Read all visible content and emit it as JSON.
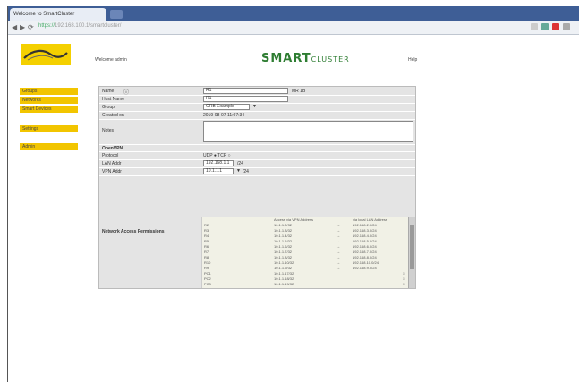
{
  "browser": {
    "tab_title": "Welcome to SmartCluster",
    "url_secure": "https://",
    "url_rest": "192.168.100.1/smartcluster/",
    "back": "◀",
    "forward": "▶",
    "reload": "⟳"
  },
  "header": {
    "logo_icon": "swoosh-logo-icon",
    "welcome": "Welcome admin",
    "brand_main": "SMART",
    "brand_sub": "CLUSTER",
    "help": "Help"
  },
  "menu": [
    {
      "label": "Groups"
    },
    {
      "label": "Networks"
    },
    {
      "label": "Smart Devices"
    },
    {
      "label": "Settings"
    },
    {
      "label": "Admin"
    }
  ],
  "form": {
    "name_label": "Name",
    "name_value": "R1",
    "name_hint": "MR 1B",
    "host_label": "Host Name",
    "host_value": "R1",
    "group_label": "Group",
    "group_value": "ORB Example",
    "created_label": "Created on",
    "created_value": "2019-08-07 11:07:34",
    "notes_label": "Notes",
    "notes_value": "",
    "openvpn_label": "OpenVPN",
    "protocol_label": "Protocol",
    "protocol_value": "UDP ● TCP ○",
    "lan_label": "LAN Addr",
    "lan_value": "192.168.1.1",
    "lan_suffix": "/24",
    "vpn_label": "VPN Addr",
    "vpn_value": "10.1.1.1",
    "vpn_suffix": "/24",
    "nap_label": "Network Access Permissions"
  },
  "na_table": {
    "col_vpn": "Access via VPN Address",
    "col_local": "via local LAN Address",
    "rows": [
      {
        "name": "R2",
        "vpn": "10.1.1.2/32",
        "local": "192.168.2.0/24"
      },
      {
        "name": "R3",
        "vpn": "10.1.1.3/32",
        "local": "192.168.3.0/24"
      },
      {
        "name": "R4",
        "vpn": "10.1.1.4/32",
        "local": "192.168.4.0/24"
      },
      {
        "name": "R5",
        "vpn": "10.1.1.5/32",
        "local": "192.168.5.0/24"
      },
      {
        "name": "R6",
        "vpn": "10.1.1.6/32",
        "local": "192.168.6.0/24"
      },
      {
        "name": "R7",
        "vpn": "10.1.1.7/32",
        "local": "192.168.7.0/24"
      },
      {
        "name": "R8",
        "vpn": "10.1.1.8/32",
        "local": "192.168.8.0/24"
      },
      {
        "name": "R10",
        "vpn": "10.1.1.10/32",
        "local": "192.168.10.0/24"
      },
      {
        "name": "R9",
        "vpn": "10.1.1.9/32",
        "local": "192.168.9.0/24"
      },
      {
        "name": "PC1",
        "vpn": "10.1.1.17/32",
        "local": ""
      },
      {
        "name": "PC2",
        "vpn": "10.1.1.18/32",
        "local": ""
      },
      {
        "name": "PC3",
        "vpn": "10.1.1.19/32",
        "local": ""
      }
    ]
  },
  "colors": {
    "accent": "#f2c500",
    "brand": "#2e7d32",
    "tabbar": "#3e5e96"
  }
}
